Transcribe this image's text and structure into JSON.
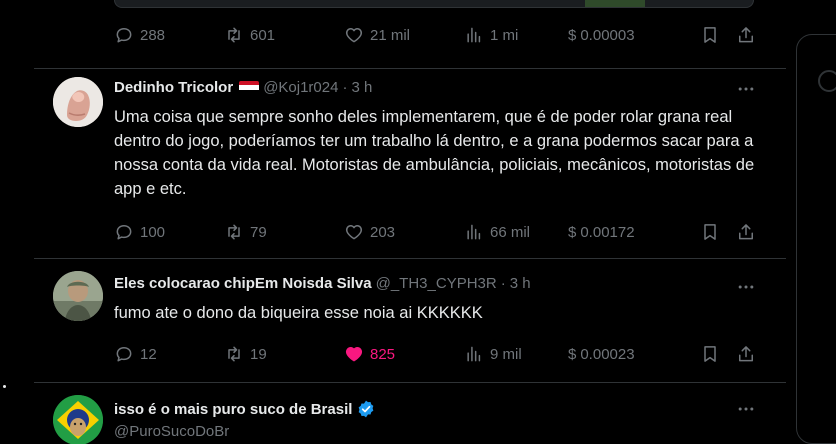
{
  "posts": [
    {
      "stats": {
        "replies": "288",
        "reposts": "601",
        "likes": "21 mil",
        "views": "1 mi",
        "tip": "0.00003"
      }
    },
    {
      "name": "Dedinho Tricolor",
      "handle": "@Koj1r024",
      "time": "3 h",
      "text": "Uma coisa que sempre sonho deles implementarem, que é de poder rolar grana real dentro do jogo, poderíamos ter um trabalho lá dentro, e a grana podermos sacar para a nossa conta da vida real. Motoristas de ambulância, policiais, mecânicos, motoristas de app e etc.",
      "stats": {
        "replies": "100",
        "reposts": "79",
        "likes": "203",
        "views": "66 mil",
        "tip": "0.00172"
      }
    },
    {
      "name": "Eles colocarao chipEm Noisda Silva",
      "handle": "@_TH3_CYPH3R",
      "time": "3 h",
      "text": "fumo ate o dono da biqueira esse noia ai KKKKKK",
      "stats": {
        "replies": "12",
        "reposts": "19",
        "likes": "825",
        "views": "9 mil",
        "tip": "0.00023"
      }
    },
    {
      "name": "isso é o mais puro suco de Brasil",
      "handle": "@PuroSucoDoBr"
    }
  ],
  "ui": {
    "separator": "·",
    "currency": "$",
    "accent_like": "#f91880",
    "accent_verified": "#1d9bf0",
    "muted": "#71767b"
  }
}
